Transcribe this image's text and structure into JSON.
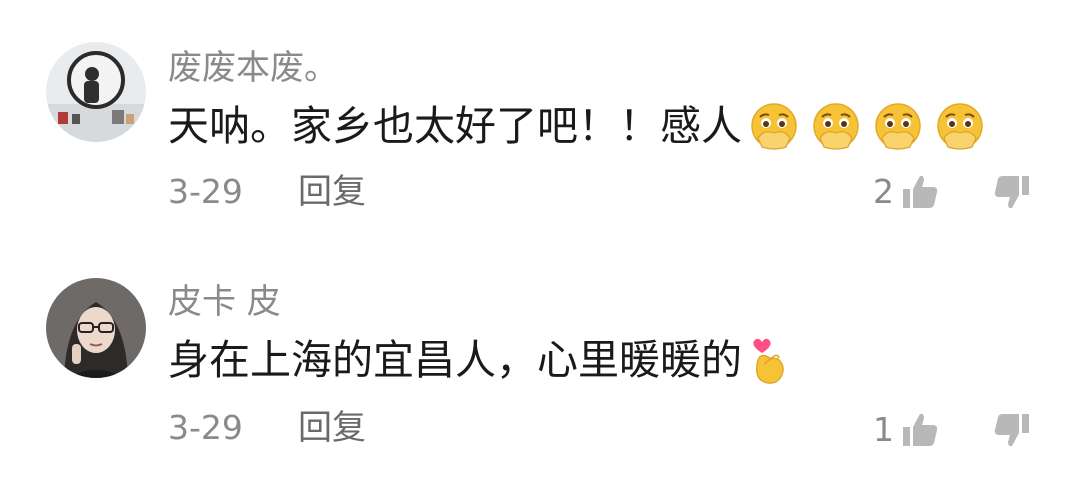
{
  "comments": [
    {
      "username": "废废本废。",
      "text": "天呐。家乡也太好了吧！！感人",
      "emojis": [
        "holding-back-tears-emoji",
        "holding-back-tears-emoji",
        "holding-back-tears-emoji",
        "holding-back-tears-emoji"
      ],
      "date": "3-29",
      "reply_label": "回复",
      "like_count": "2"
    },
    {
      "username": "皮卡 皮",
      "text": "身在上海的宜昌人，心里暖暖的",
      "emojis": [
        "finger-heart-emoji"
      ],
      "date": "3-29",
      "reply_label": "回复",
      "like_count": "1"
    }
  ],
  "colors": {
    "meta_gray": "#8a8a8a",
    "icon_gray": "#b8b8b8",
    "emoji_yellow": "#f7c336"
  }
}
